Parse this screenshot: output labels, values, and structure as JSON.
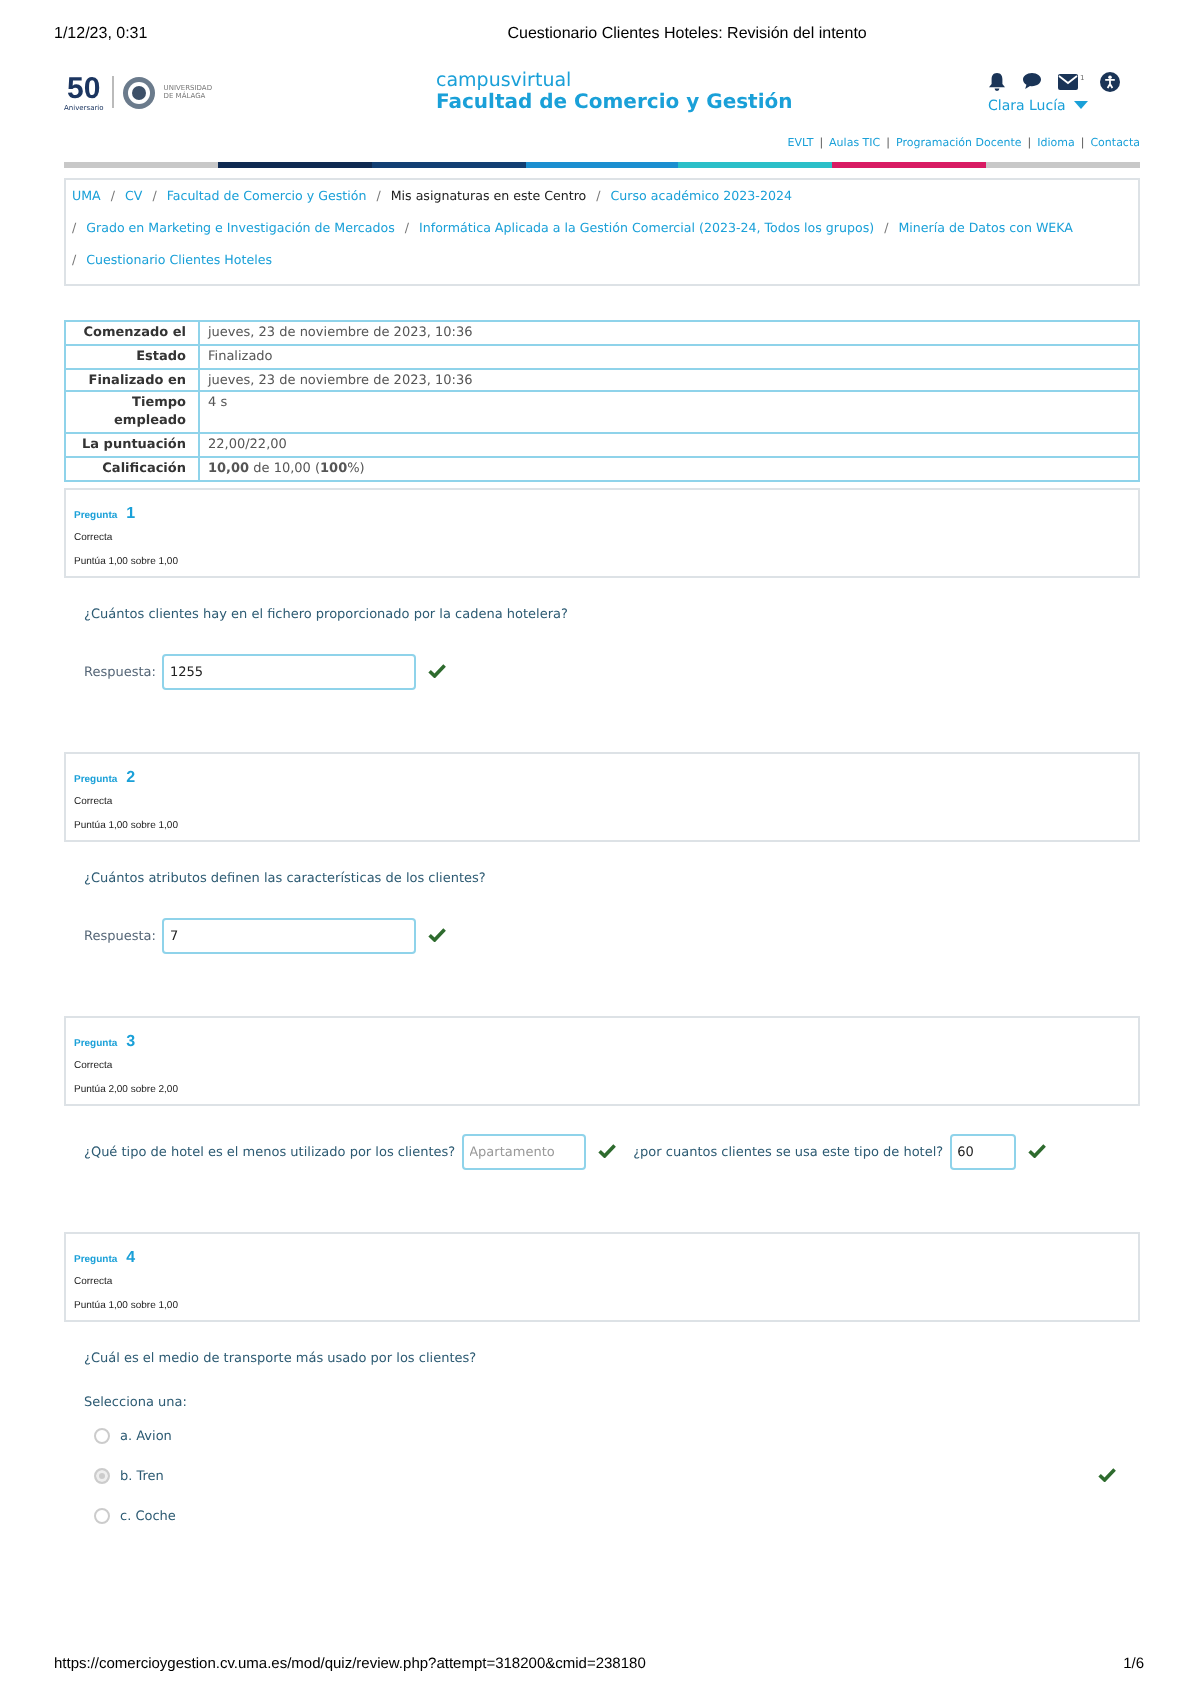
{
  "print_header": {
    "date": "1/12/23, 0:31",
    "title": "Cuestionario Clientes Hoteles: Revisión del intento"
  },
  "header": {
    "logo_number": "50",
    "logo_caption": "Aniversario",
    "university": "UNIVERSIDAD DE MÁLAGA",
    "site": "campusvirtual",
    "faculty": "Facultad de Comercio y Gestión",
    "user": "Clara Lucía",
    "messages_badge": "1"
  },
  "top_links": [
    {
      "label": "EVLT"
    },
    {
      "sep": "|",
      "label": "Aulas TIC"
    },
    {
      "sep": "|",
      "label": "Programación Docente"
    },
    {
      "sep": "|",
      "label": "Idioma"
    },
    {
      "sep": "|",
      "label": "Contacta"
    }
  ],
  "breadcrumb": [
    {
      "label": "UMA",
      "link": true
    },
    {
      "sep": "/",
      "label": "CV",
      "link": true
    },
    {
      "sep": "/",
      "label": "Facultad de Comercio y Gestión",
      "link": true
    },
    {
      "sep": "/",
      "label": "Mis asignaturas en este Centro",
      "link": false
    },
    {
      "sep": "/",
      "label": "Curso académico 2023-2024",
      "link": true
    },
    {
      "sep": "/",
      "label": "Grado en Marketing e Investigación de Mercados",
      "link": true
    },
    {
      "sep": "/",
      "label": "Informática Aplicada a la Gestión Comercial (2023-24, Todos los grupos)",
      "link": true
    },
    {
      "sep": "/",
      "label": "Minería de Datos con WEKA",
      "link": true
    },
    {
      "sep": "/",
      "label": "Cuestionario Clientes Hoteles",
      "link": true
    }
  ],
  "summary": [
    {
      "label": "Comenzado el",
      "value": "jueves, 23 de noviembre de 2023, 10:36"
    },
    {
      "label": "Estado",
      "value": "Finalizado"
    },
    {
      "label": "Finalizado en",
      "value": "jueves, 23 de noviembre de 2023, 10:36"
    },
    {
      "label": "Tiempo empleado",
      "value": "4 s"
    },
    {
      "label": "La puntuación",
      "value": "22,00/22,00"
    },
    {
      "label": "Calificación",
      "value": "**10,00** de 10,00 (**100**%)"
    }
  ],
  "questions": [
    {
      "word": "Pregunta",
      "number": "1",
      "status": "Correcta",
      "score": "Puntúa 1,00 sobre 1,00",
      "kind": "short",
      "text": "¿Cuántos clientes hay en el fichero proporcionado por la cadena hotelera?",
      "answer_label": "Respuesta:",
      "answer": "1255",
      "correct": true
    },
    {
      "word": "Pregunta",
      "number": "2",
      "status": "Correcta",
      "score": "Puntúa 1,00 sobre 1,00",
      "kind": "short",
      "text": "¿Cuántos atributos definen las características de los clientes?",
      "answer_label": "Respuesta:",
      "answer": "7",
      "correct": true
    },
    {
      "word": "Pregunta",
      "number": "3",
      "status": "Correcta",
      "score": "Puntúa 2,00 sobre 2,00",
      "kind": "multi",
      "parts": [
        {
          "prompt": "¿Qué tipo de hotel es el menos utilizado por los clientes?",
          "answer": "Apartamento",
          "correct": true,
          "disabled": true
        },
        {
          "prompt": "¿por cuantos clientes se usa este tipo de hotel?",
          "answer": "60",
          "correct": true,
          "disabled": false
        }
      ]
    },
    {
      "word": "Pregunta",
      "number": "4",
      "status": "Correcta",
      "score": "Puntúa 1,00 sobre 1,00",
      "kind": "choice",
      "text": "¿Cuál es el medio de transporte más usado por los clientes?",
      "instruction": "Selecciona una:",
      "options": [
        {
          "label": "a. Avion",
          "selected": false
        },
        {
          "label": "b. Tren",
          "selected": true
        },
        {
          "label": "c. Coche",
          "selected": false
        }
      ],
      "correct": true
    }
  ],
  "print_footer": {
    "url": "https://comercioygestion.cv.uma.es/mod/quiz/review.php?attempt=318200&cmid=238180",
    "page": "1/6"
  }
}
